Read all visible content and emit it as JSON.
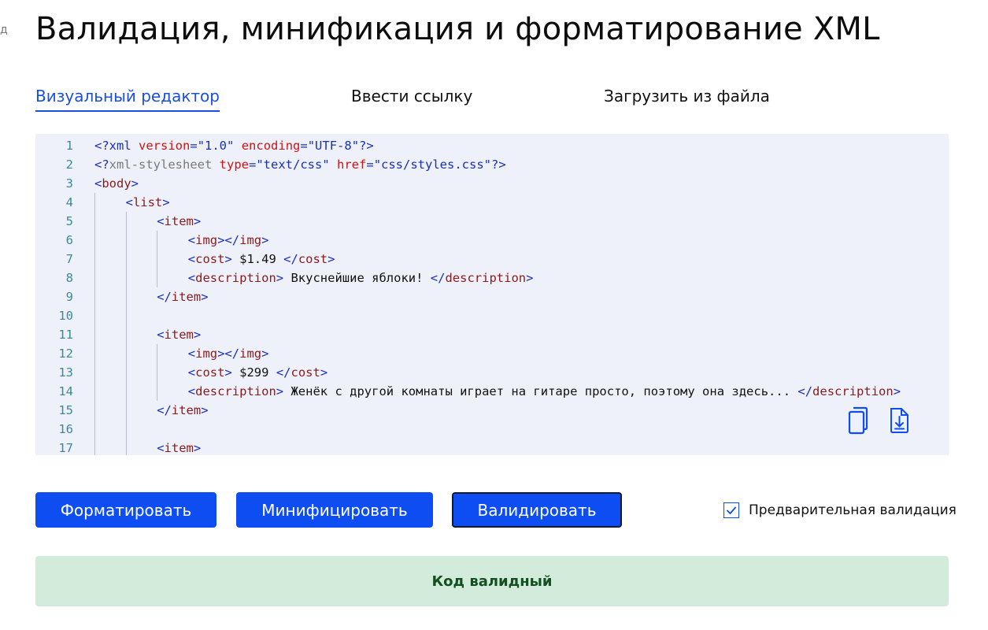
{
  "page": {
    "edge_glyph": "д",
    "title": "Валидация, минификация и форматирование XML"
  },
  "tabs": [
    {
      "label": "Визуальный редактор",
      "active": true
    },
    {
      "label": "Ввести ссылку",
      "active": false
    },
    {
      "label": "Загрузить из файла",
      "active": false
    }
  ],
  "editor": {
    "lines": [
      {
        "n": "1",
        "indent": 0,
        "tokens": [
          [
            "pi",
            "<?xml"
          ],
          [
            "txt",
            " "
          ],
          [
            "attr",
            "version"
          ],
          [
            "pi",
            "="
          ],
          [
            "val",
            "\"1.0\""
          ],
          [
            "txt",
            " "
          ],
          [
            "attr",
            "encoding"
          ],
          [
            "pi",
            "="
          ],
          [
            "val",
            "\"UTF-8\""
          ],
          [
            "pi",
            "?>"
          ]
        ]
      },
      {
        "n": "2",
        "indent": 0,
        "tokens": [
          [
            "pi",
            "<?"
          ],
          [
            "pin",
            "xml-stylesheet"
          ],
          [
            "txt",
            " "
          ],
          [
            "attr",
            "type"
          ],
          [
            "pi",
            "="
          ],
          [
            "val",
            "\"text/css\""
          ],
          [
            "txt",
            " "
          ],
          [
            "attr",
            "href"
          ],
          [
            "pi",
            "="
          ],
          [
            "val",
            "\"css/styles.css\""
          ],
          [
            "pi",
            "?>"
          ]
        ]
      },
      {
        "n": "3",
        "indent": 0,
        "tokens": [
          [
            "br",
            "<"
          ],
          [
            "tag",
            "body"
          ],
          [
            "br",
            ">"
          ]
        ]
      },
      {
        "n": "4",
        "indent": 1,
        "tokens": [
          [
            "br",
            "<"
          ],
          [
            "tag",
            "list"
          ],
          [
            "br",
            ">"
          ]
        ]
      },
      {
        "n": "5",
        "indent": 2,
        "tokens": [
          [
            "br",
            "<"
          ],
          [
            "tag",
            "item"
          ],
          [
            "br",
            ">"
          ]
        ]
      },
      {
        "n": "6",
        "indent": 3,
        "tokens": [
          [
            "br",
            "<"
          ],
          [
            "tag",
            "img"
          ],
          [
            "br",
            "></"
          ],
          [
            "tag",
            "img"
          ],
          [
            "br",
            ">"
          ]
        ]
      },
      {
        "n": "7",
        "indent": 3,
        "tokens": [
          [
            "br",
            "<"
          ],
          [
            "tag",
            "cost"
          ],
          [
            "br",
            ">"
          ],
          [
            "txt",
            " $1.49 "
          ],
          [
            "br",
            "</"
          ],
          [
            "tag",
            "cost"
          ],
          [
            "br",
            ">"
          ]
        ]
      },
      {
        "n": "8",
        "indent": 3,
        "tokens": [
          [
            "br",
            "<"
          ],
          [
            "tag",
            "description"
          ],
          [
            "br",
            ">"
          ],
          [
            "txt",
            " Вкуснейшие яблоки! "
          ],
          [
            "br",
            "</"
          ],
          [
            "tag",
            "description"
          ],
          [
            "br",
            ">"
          ]
        ]
      },
      {
        "n": "9",
        "indent": 2,
        "tokens": [
          [
            "br",
            "</"
          ],
          [
            "tag",
            "item"
          ],
          [
            "br",
            ">"
          ]
        ]
      },
      {
        "n": "10",
        "indent": 0,
        "tokens": []
      },
      {
        "n": "11",
        "indent": 2,
        "tokens": [
          [
            "br",
            "<"
          ],
          [
            "tag",
            "item"
          ],
          [
            "br",
            ">"
          ]
        ]
      },
      {
        "n": "12",
        "indent": 3,
        "tokens": [
          [
            "br",
            "<"
          ],
          [
            "tag",
            "img"
          ],
          [
            "br",
            "></"
          ],
          [
            "tag",
            "img"
          ],
          [
            "br",
            ">"
          ]
        ]
      },
      {
        "n": "13",
        "indent": 3,
        "tokens": [
          [
            "br",
            "<"
          ],
          [
            "tag",
            "cost"
          ],
          [
            "br",
            ">"
          ],
          [
            "txt",
            " $299 "
          ],
          [
            "br",
            "</"
          ],
          [
            "tag",
            "cost"
          ],
          [
            "br",
            ">"
          ]
        ]
      },
      {
        "n": "14",
        "indent": 3,
        "tokens": [
          [
            "br",
            "<"
          ],
          [
            "tag",
            "description"
          ],
          [
            "br",
            ">"
          ],
          [
            "txt",
            " Женёк с другой комнаты играет на гитаре просто, поэтому она здесь... "
          ],
          [
            "br",
            "</"
          ],
          [
            "tag",
            "description"
          ],
          [
            "br",
            ">"
          ]
        ]
      },
      {
        "n": "15",
        "indent": 2,
        "tokens": [
          [
            "br",
            "</"
          ],
          [
            "tag",
            "item"
          ],
          [
            "br",
            ">"
          ]
        ]
      },
      {
        "n": "16",
        "indent": 0,
        "tokens": []
      },
      {
        "n": "17",
        "indent": 2,
        "tokens": [
          [
            "br",
            "<"
          ],
          [
            "tag",
            "item"
          ],
          [
            "br",
            ">"
          ]
        ]
      }
    ],
    "copy_icon": "copy-icon",
    "download_icon": "download-icon"
  },
  "actions": {
    "format_label": "Форматировать",
    "minify_label": "Минифицировать",
    "validate_label": "Валидировать"
  },
  "prevalidation": {
    "label": "Предварительная валидация",
    "checked": true
  },
  "result": {
    "message": "Код валидный"
  },
  "colors": {
    "accent": "#0d4df2",
    "success_bg": "#d3ebda",
    "success_text": "#14501f",
    "editor_bg": "#eef1f9"
  }
}
